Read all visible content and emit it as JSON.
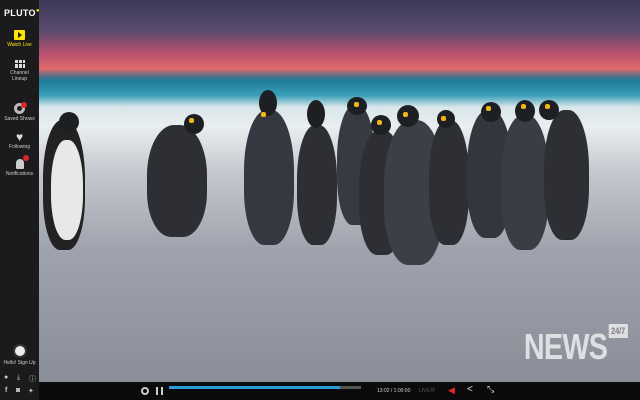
{
  "sidebar": {
    "logo": "PLUTO",
    "items": [
      {
        "label": "Watch Live",
        "icon": "play-tv-icon",
        "active": true
      },
      {
        "label": "Channel Lineup",
        "icon": "grid-icon"
      },
      {
        "label": "Saved Shows",
        "icon": "saved-disc-icon",
        "badge": true
      },
      {
        "label": "Following",
        "icon": "heart-icon"
      },
      {
        "label": "Notifications",
        "icon": "bell-icon",
        "badge": true
      }
    ],
    "signup": "Hello! Sign Up",
    "bottom_icons": [
      "info-icon",
      "download-icon",
      "help-icon",
      "facebook-icon",
      "instagram-icon",
      "twitter-icon"
    ]
  },
  "video": {
    "watermark": "NEWS",
    "watermark_badge": "24/7"
  },
  "controls": {
    "time": "13:02 / 1:00:00",
    "live_label": "LIVE",
    "progress": 0.89,
    "accent": "#2c9ad6"
  }
}
